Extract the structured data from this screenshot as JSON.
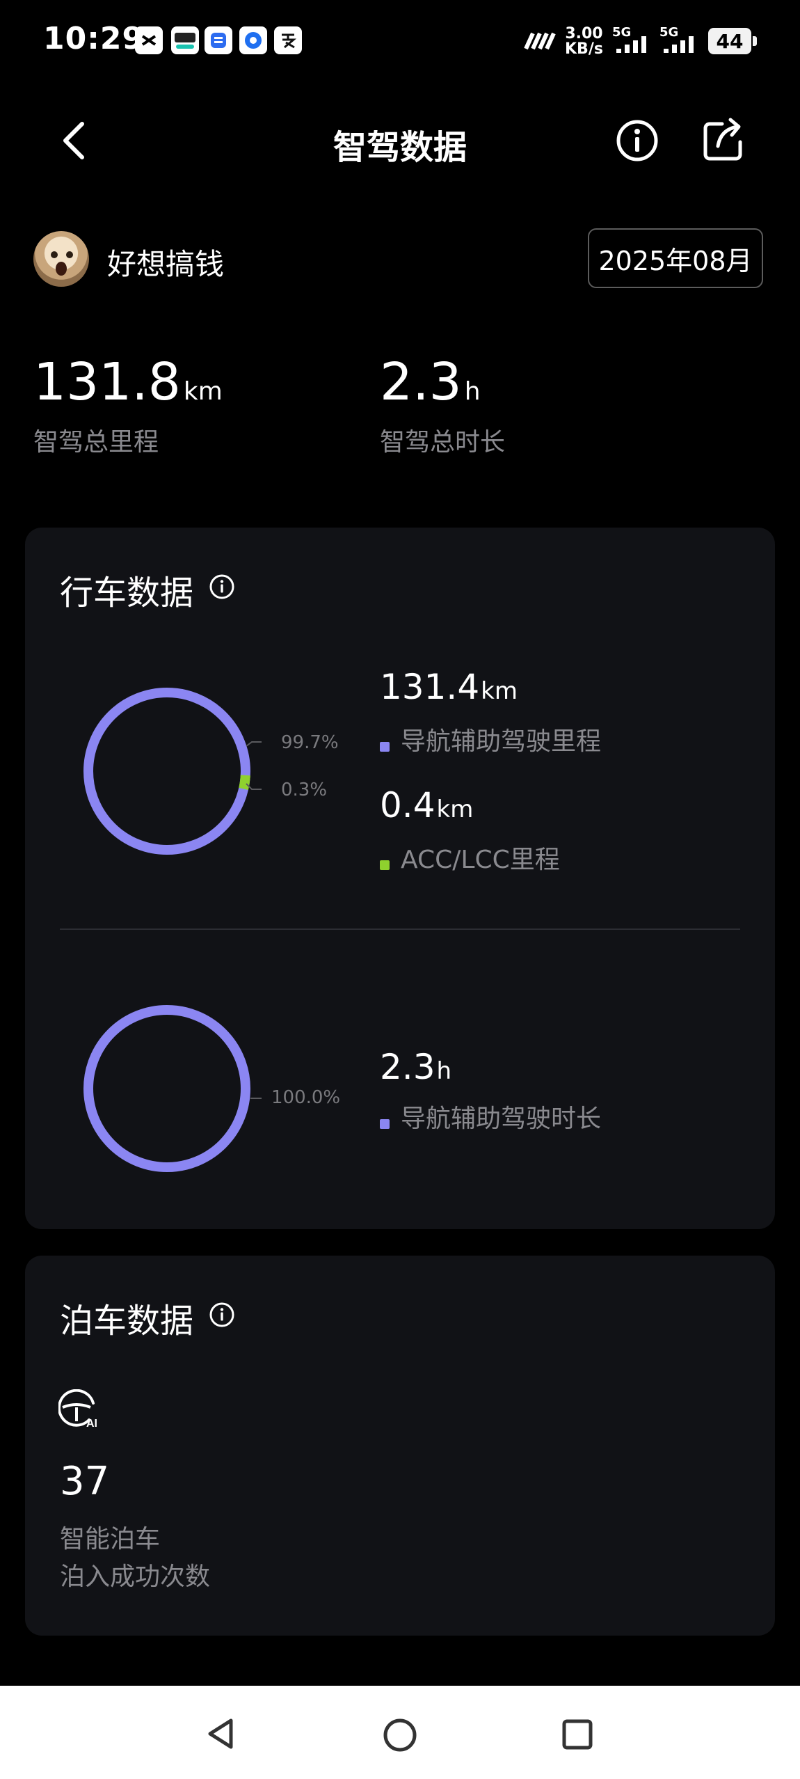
{
  "status_bar": {
    "time": "10:29",
    "net_speed_value": "3.00",
    "net_speed_unit": "KB/s",
    "signal1_label": "5G",
    "signal2_label": "5G",
    "battery": "44"
  },
  "header": {
    "title": "智驾数据",
    "back_icon": "back-chevron-icon",
    "info_icon": "info-icon",
    "share_icon": "share-icon"
  },
  "user": {
    "name": "好想搞钱",
    "month": "2025年08月"
  },
  "summary": {
    "total_distance_value": "131.8",
    "total_distance_unit": "km",
    "total_distance_label": "智驾总里程",
    "total_time_value": "2.3",
    "total_time_unit": "h",
    "total_time_label": "智驾总时长"
  },
  "driving": {
    "title": "行车数据",
    "distance_chart": {
      "pct_main": "99.7%",
      "pct_minor": "0.3%",
      "share_main": 0.997,
      "share_minor": 0.003,
      "color_main": "#8b86f2",
      "color_minor": "#8fd12e"
    },
    "nav_distance_value": "131.4",
    "nav_distance_unit": "km",
    "nav_distance_label": "导航辅助驾驶里程",
    "acc_distance_value": "0.4",
    "acc_distance_unit": "km",
    "acc_distance_label": "ACC/LCC里程",
    "time_chart": {
      "pct": "100.0%",
      "share": 1.0,
      "color": "#8b86f2"
    },
    "nav_time_value": "2.3",
    "nav_time_unit": "h",
    "nav_time_label": "导航辅助驾驶时长"
  },
  "parking": {
    "title": "泊车数据",
    "icon": "ai-steering-wheel-icon",
    "count": "37",
    "label_line1": "智能泊车",
    "label_line2": "泊入成功次数"
  },
  "nav_bar": {
    "back": "back-triangle-icon",
    "home": "home-circle-icon",
    "recents": "recents-square-icon"
  }
}
